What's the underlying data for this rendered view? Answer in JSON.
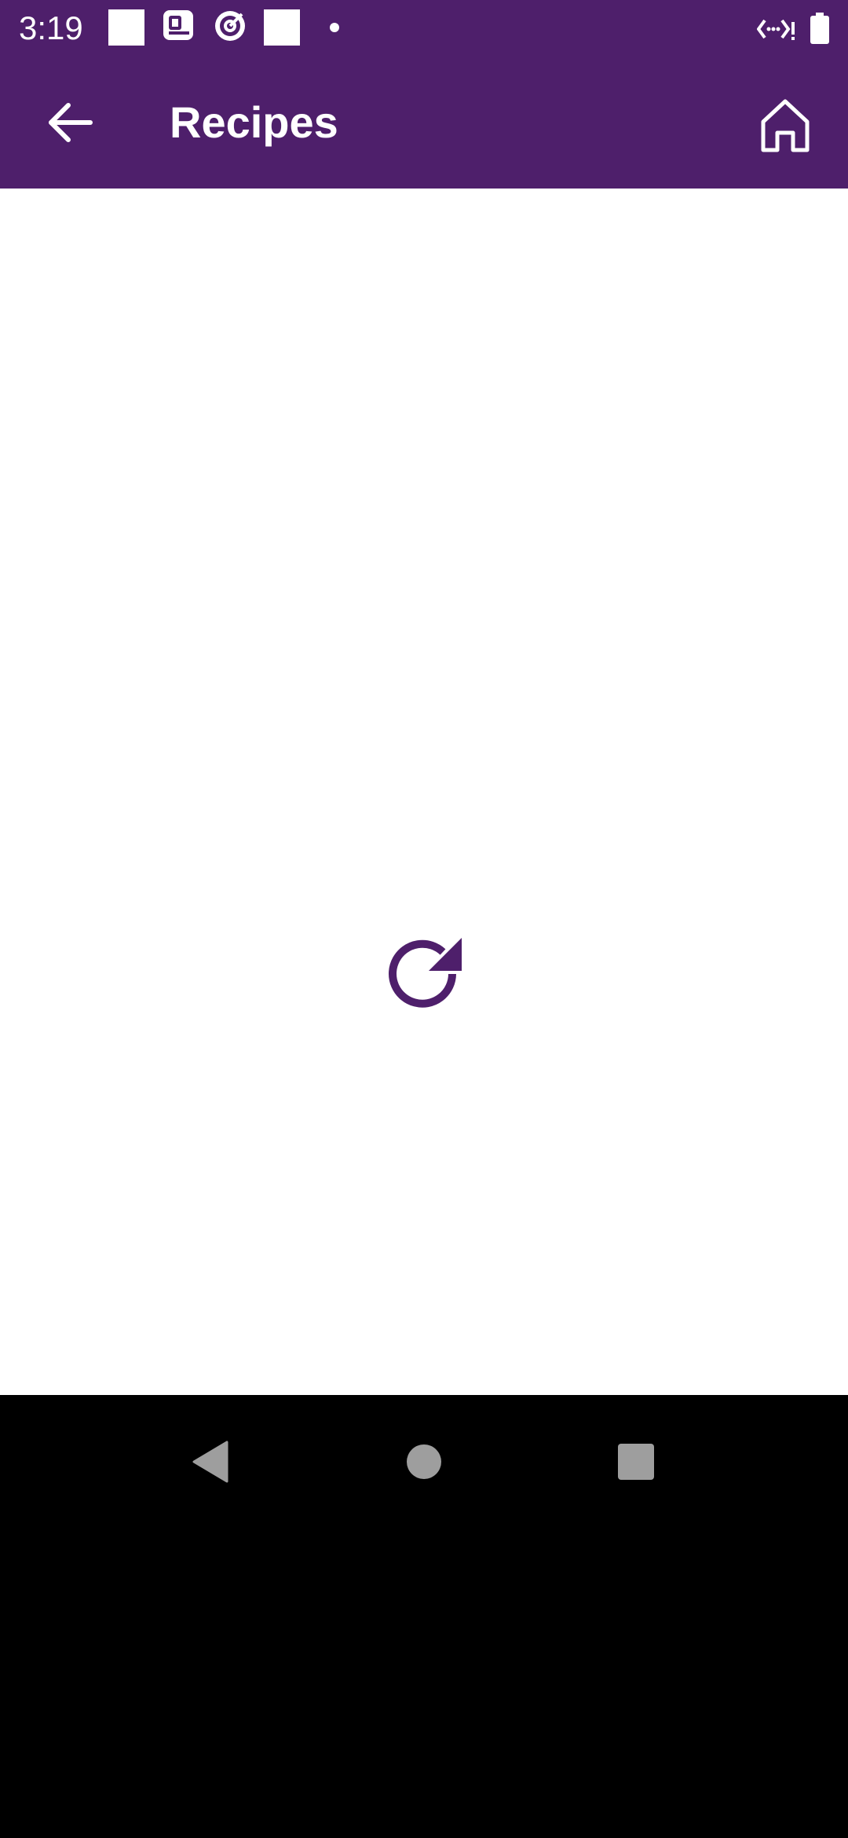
{
  "status_bar": {
    "time": "3:19",
    "icons": [
      "notification-square-icon",
      "news-app-icon",
      "target-app-icon",
      "notification-square-icon",
      "dot-icon",
      "network-icon",
      "battery-icon"
    ]
  },
  "app_bar": {
    "title": "Recipes",
    "back_icon": "arrow-left-icon",
    "home_icon": "home-icon"
  },
  "content": {
    "reload_icon": "refresh-icon"
  },
  "nav_bar": {
    "buttons": [
      "back-triangle-icon",
      "home-circle-icon",
      "recents-square-icon"
    ]
  },
  "colors": {
    "primary": "#4e1f6b",
    "background": "#ffffff",
    "nav_background": "#000000",
    "nav_icon": "#9e9e9e"
  }
}
